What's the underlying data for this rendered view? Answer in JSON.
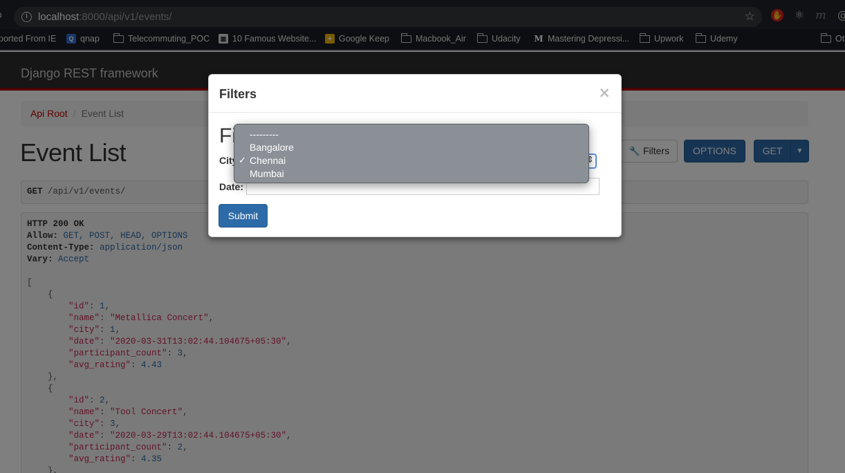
{
  "browser": {
    "url_host": "localhost",
    "url_path": ":8000/api/v1/events/",
    "bookmarks": [
      {
        "label": "ported From IE"
      },
      {
        "label": "qnap"
      },
      {
        "label": "Telecommuting_POC"
      },
      {
        "label": "10 Famous Website..."
      },
      {
        "label": "Google Keep"
      },
      {
        "label": "Macbook_Air"
      },
      {
        "label": "Udacity"
      },
      {
        "label": "Mastering Depressi..."
      },
      {
        "label": "Upwork"
      },
      {
        "label": "Udemy"
      },
      {
        "label": "Ot"
      }
    ]
  },
  "page": {
    "brand": "Django REST framework",
    "breadcrumb": {
      "root": "Api Root",
      "current": "Event List"
    },
    "title": "Event List",
    "buttons": {
      "filters": "Filters",
      "options": "OPTIONS",
      "get": "GET"
    },
    "request": {
      "method": "GET",
      "path": " /api/v1/events/"
    }
  },
  "response": {
    "status": "HTTP 200 OK",
    "headers": [
      {
        "name": "Allow:",
        "value": "GET, POST, HEAD, OPTIONS"
      },
      {
        "name": "Content-Type:",
        "value": "application/json"
      },
      {
        "name": "Vary:",
        "value": "Accept"
      }
    ],
    "events": [
      {
        "id": "1",
        "name": "\"Metallica Concert\"",
        "city": "1",
        "date": "\"2020-03-31T13:02:44.104675+05:30\"",
        "participant_count": "3",
        "avg_rating": "4.43"
      },
      {
        "id": "2",
        "name": "\"Tool Concert\"",
        "city": "3",
        "date": "\"2020-03-29T13:02:44.104675+05:30\"",
        "participant_count": "2",
        "avg_rating": "4.35"
      }
    ]
  },
  "modal": {
    "title": "Filters",
    "close": "×",
    "legend": "Field filters",
    "city_label": "City:",
    "date_label": "Date:",
    "submit": "Submit",
    "city_options": [
      "---------",
      "Bangalore",
      "Chennai",
      "Mumbai"
    ],
    "city_selected": "Chennai"
  },
  "colors": {
    "accent": "#2c6aa8",
    "navbar_border": "#a30000",
    "link": "#c20000"
  }
}
